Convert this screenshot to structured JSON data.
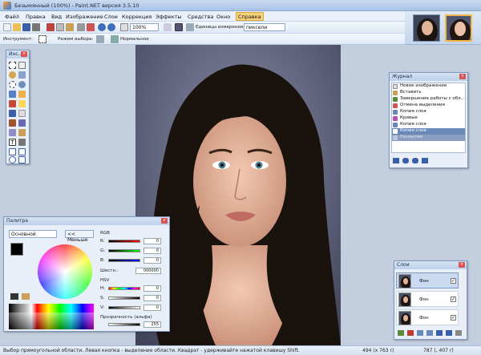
{
  "window": {
    "title": "Безымянный (100%) - Paint.NET версия 3.5.10"
  },
  "menu": [
    "Файл",
    "Правка",
    "Вид",
    "Изображение",
    "Слои",
    "Коррекция",
    "Эффекты",
    "Средства",
    "Окно",
    "Справка"
  ],
  "toolbar": {
    "zoom": "100%",
    "units_label": "Единицы измерения:",
    "units_value": "пиксели"
  },
  "toolbar2": {
    "tool_label": "Инструмент:",
    "mode_label": "Режим выбора:",
    "blend_value": "Нормальное"
  },
  "tools_window": {
    "title": "Инс..."
  },
  "history_window": {
    "title": "Журнал",
    "items": [
      "Новое изображение",
      "Вставить",
      "Завершение работы с обл...",
      "Отмена выделения",
      "Копия слоя",
      "Кривые",
      "Копия слоя",
      "Копия слоя",
      "Размытие"
    ]
  },
  "palette_window": {
    "title": "Палитра",
    "primary": "Основной",
    "less_button": "<< Меньше",
    "rgb_label": "RGB",
    "r_label": "R:",
    "g_label": "G:",
    "b_label": "B:",
    "r": "0",
    "g": "0",
    "b": "0",
    "hex_label": "Шестн.:",
    "hex": "000000",
    "hsv_label": "HSV",
    "h_label": "H:",
    "s_label": "S:",
    "v_label": "V:",
    "h": "0",
    "s": "0",
    "v": "0",
    "alpha_label": "Прозрачность (альфа)",
    "alpha": "255"
  },
  "layers_window": {
    "title": "Слои",
    "layers": [
      {
        "name": "Фон"
      },
      {
        "name": "Фон"
      },
      {
        "name": "Фон"
      }
    ]
  },
  "status": {
    "hint": "Выбор прямоугольной области. Левая кнопка - выделение области. Квадрат - удерживайте нажатой клавишу Shift.",
    "size": "494 (x 763 r)",
    "pos": "787 (, 407 r)"
  },
  "colors": {
    "accent": "#f7d27a",
    "panel": "#e9eff8",
    "canvas_bg": "#c3cfdf"
  }
}
